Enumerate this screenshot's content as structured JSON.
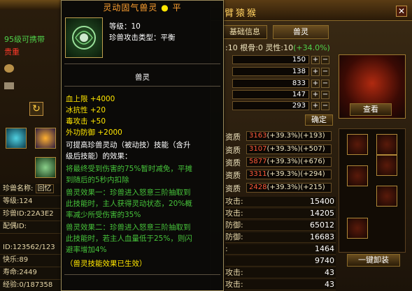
{
  "left": {
    "level_owner": "95级可携带",
    "rarity": "贵重",
    "pet_name_label": "珍兽名称:",
    "pet_name_value": "回忆",
    "level": "等级:124",
    "pet_id": "珍兽ID:22A3E2",
    "spouse_id": "配偶ID:",
    "id_value": "ID:123562/123",
    "happy": "快乐:89",
    "life": "寿命:2449",
    "exp": "经验:0/187358"
  },
  "tooltip": {
    "title_left": "灵动固气兽灵",
    "title_dot": "●",
    "title_right": "平",
    "level": "等级：10",
    "attack_type": "珍兽攻击类型：平衡",
    "slot_label": "兽灵",
    "effects": [
      "血上限 +4000",
      "冰抗性 +20",
      "毒攻击 +50",
      "外功防御 +2000"
    ],
    "skill_line1": "可提高珍兽灵动（被动技）技能（含升",
    "skill_line2": "级后技能）的效果：",
    "green1": [
      "将最终受到伤害的75%暂时减免，平摊",
      "到随后的5秒内扣除"
    ],
    "green2": [
      "兽灵效果一：珍兽进入怒意三阶抽取到",
      "此技能时，主人获得灵动状态，20%概",
      "率减少所受伤害的35%"
    ],
    "green3": [
      "兽灵效果二：珍兽进入怒意三阶抽取到",
      "此技能时，若主人血量低于25%，则闪",
      "避率增加4%"
    ],
    "footer": "（兽灵技能效果已生效）"
  },
  "window": {
    "title": "臂猿猴",
    "tab_basic": "基础信息",
    "tab_spirit": "兽灵",
    "attr_line": ":10  根骨:0    灵性:10",
    "attr_bonus": "(+34.0%)",
    "bars": [
      "150",
      "138",
      "833",
      "147",
      "293"
    ],
    "confirm": "确定",
    "view": "查看",
    "one_key": "一键卸装",
    "aptitudes": [
      {
        "label": "资质",
        "v": "3163",
        "b": "(+39.3%)",
        "p": "(+193)"
      },
      {
        "label": "资质",
        "v": "3107",
        "b": "(+39.3%)",
        "p": "(+507)"
      },
      {
        "label": "资质",
        "v": "5877",
        "b": "(+39.3%)",
        "p": "(+676)"
      },
      {
        "label": "资质",
        "v": "3311",
        "b": "(+39.3%)",
        "p": "(+294)"
      },
      {
        "label": "资质",
        "v": "2428",
        "b": "(+39.3%)",
        "p": "(+215)"
      }
    ],
    "stats": [
      {
        "k": "攻击:",
        "v": "15400"
      },
      {
        "k": "攻击:",
        "v": "14205"
      },
      {
        "k": "防御:",
        "v": "65012"
      },
      {
        "k": "防御:",
        "v": "16683"
      },
      {
        "k": ":",
        "v": "1464"
      },
      {
        "k": "",
        "v": "9740"
      },
      {
        "k": "攻击:",
        "v": "43"
      },
      {
        "k": "攻击:",
        "v": "43"
      }
    ]
  },
  "colors": {
    "gold": "#ffe600",
    "green": "#46c23a",
    "red": "#ff5a3a",
    "border": "#9a8a5a"
  }
}
